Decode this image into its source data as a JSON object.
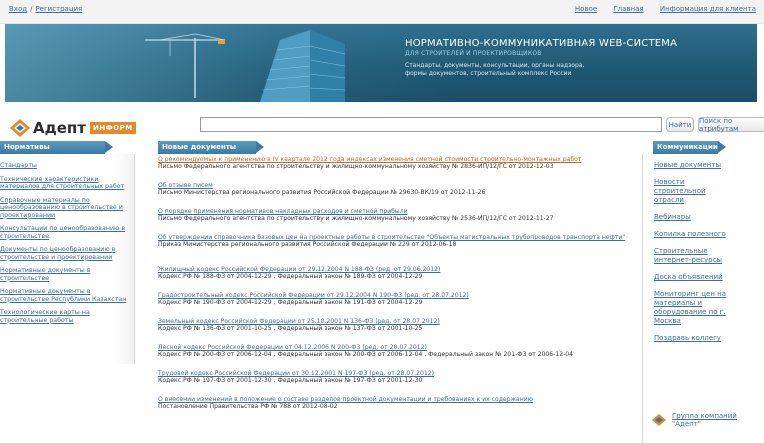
{
  "topbar": {
    "login": "Вход",
    "separator": "/",
    "register": "Регистрация",
    "links": [
      "Новое",
      "Главная",
      "Информация для клиента"
    ]
  },
  "banner": {
    "title": "НОРМАТИВНО-КОММУНИКАТИВНАЯ WEB-СИСТЕМА",
    "subtitle": "ДЛЯ СТРОИТЕЛЕЙ И ПРОЕКТИРОВЩИКОВ",
    "desc_line1": "Стандарты, документы, консультации, органы надзора,",
    "desc_line2": "формы документов, строительный комплекс России"
  },
  "logo": {
    "name": "Адепт",
    "badge": "ИНФОРМ"
  },
  "search": {
    "value": "",
    "find_label": "Найти",
    "attr_label": "Поиск по атрибутам"
  },
  "colors": {
    "panel_header": "#3a7aa3",
    "link": "#3a6ea5",
    "accent_orange": "#e3892b",
    "banner": "#1f5975"
  },
  "left": {
    "header": "Нормативы",
    "items": [
      "Стандарты",
      "Технические характеристики материалов для строительных работ",
      "Справочные материалы по ценообразованию в строительстве и проектировании",
      "Консультации по ценообразованию в строительстве",
      "Документы по ценообразованию в строительстве и проектировании",
      "Нормативные документы в строительстве",
      "Нормативные документы в строительстве Республики Казахстан",
      "Технологические карты на строительные работы"
    ]
  },
  "main": {
    "header": "Новые документы",
    "docs": [
      {
        "title": "О рекомендуемых к применению в IV квартале 2012 года индексах изменения сметной стоимости строительно-монтажных работ",
        "desc": "Письмо Федерального агентства по строительству и жилищно-коммунальному хозяйству № 2836-ИП/12/ГС от 2012-12-03"
      },
      {
        "title": "Об отзыве писем",
        "desc": "Письмо Министерства регионального развития Российской Федерации № 29630-ВК/19 от 2012-11-26"
      },
      {
        "title": "О порядке применения нормативов накладных расходов и сметной прибыли",
        "desc": "Письмо Федерального агентства по строительству и жилищно-коммунальному хозяйству № 2536-ИП/12/ГС от 2012-11-27"
      },
      {
        "title": "Об утверждении справочника базовых цен на проектные работы в строительстве \"Объекты магистральных трубопроводов транспорта нефти\"",
        "desc": "Приказ Министерства регионального развития Российской Федерации № 229 от 2012-06-18"
      },
      {
        "title": "Жилищный кодекс Российской Федерации от 29.12.2004 N 188-ФЗ (ред. от 29.06.2012)",
        "desc": "Кодекс РФ № 188-ФЗ от 2004-12-29 , Федеральный закон № 189-ФЗ от 2004-12-29"
      },
      {
        "title": "Градостроительный кодекс Российской Федерации от 29.12.2004 N 190-ФЗ (ред. от 28.07.2012)",
        "desc": "Кодекс РФ № 190-ФЗ от 2004-12-29 , Федеральный закон № 191-ФЗ от 2004-12-29"
      },
      {
        "title": "Земельный кодекс Российской Федерации от 25.10.2001 N 136-ФЗ (ред. от 28.07.2012)",
        "desc": "Кодекс РФ № 136-ФЗ от 2001-10-25 , Федеральный закон № 137-ФЗ от 2001-10-25"
      },
      {
        "title": "Лесной кодекс Российской Федерации от 04.12.2006 N 200-ФЗ (ред. от 28.07.2012)",
        "desc": "Кодекс РФ № 200-ФЗ от 2006-12-04 , Федеральный закон № 200-ФЗ от 2006-12-04 , Федеральный закон № 201-ФЗ от 2006-12-04"
      },
      {
        "title": "Трудовой кодекс Российской Федерации от 30.12.2001 N 197-ФЗ (ред. от 28.07.2012)",
        "desc": "Кодекс РФ № 197-ФЗ от 2001-12-30 , Федеральный закон № 197-ФЗ от 2001-12-30"
      },
      {
        "title": "О внесении изменений в положение о составе разделов проектной документации и требованиях к их содержанию",
        "desc": "Постановление Правительства РФ № 788 от 2012-08-02"
      }
    ]
  },
  "right": {
    "header": "Коммуникации",
    "items": [
      "Новые документы",
      "Новости строительной отрасли",
      "Вебинары",
      "Копилка полезного",
      "Строительные интернет-ресурсы",
      "Доска объявлений",
      "Мониторинг цен на материалы и оборудование по г. Москва",
      "Поздравь коллегу"
    ],
    "company_link": "Группа компаний",
    "company_name": "\"Адепт\""
  }
}
